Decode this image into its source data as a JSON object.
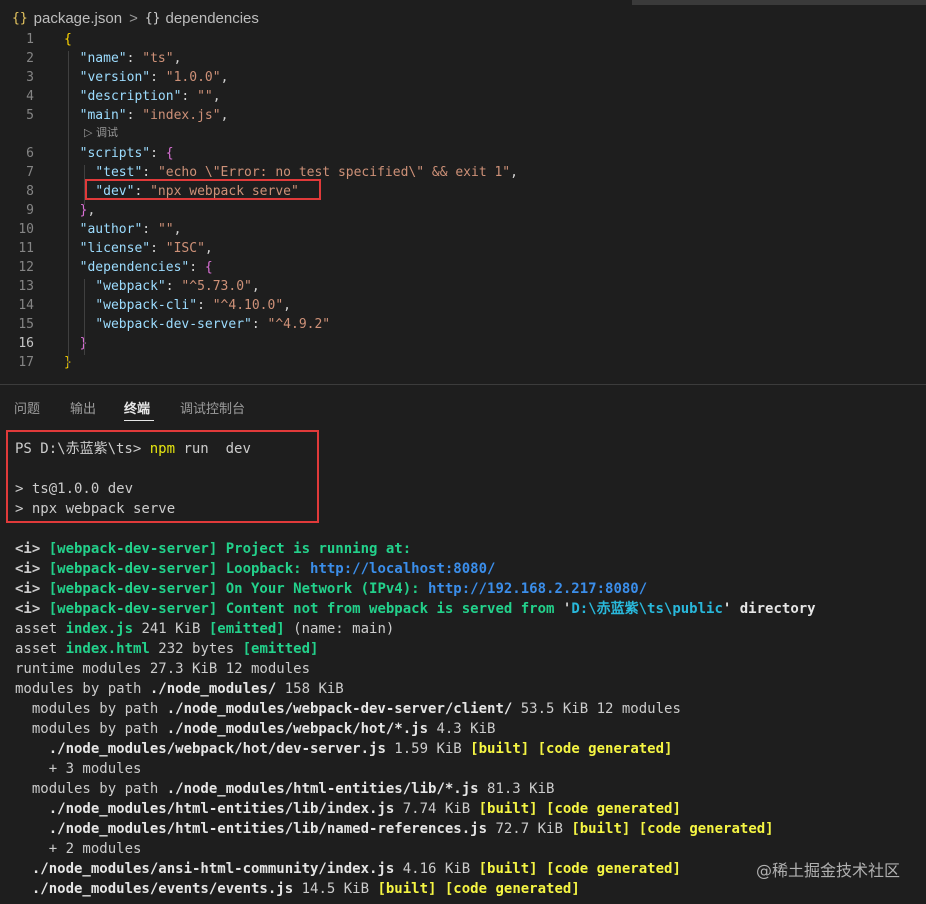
{
  "breadcrumb": {
    "file_icon": "{}",
    "file": "package.json",
    "separator": ">",
    "symbol_icon": "{}",
    "symbol": "dependencies"
  },
  "editor": {
    "active_line": 16,
    "code_lens": "▷ 调试",
    "lines": [
      {
        "n": "1",
        "tokens": [
          {
            "t": "{",
            "c": "b1"
          }
        ]
      },
      {
        "n": "2",
        "tokens": [
          {
            "t": "  "
          },
          {
            "t": "\"name\"",
            "c": "k"
          },
          {
            "t": ": ",
            "c": "p"
          },
          {
            "t": "\"ts\"",
            "c": "s"
          },
          {
            "t": ",",
            "c": "p"
          }
        ]
      },
      {
        "n": "3",
        "tokens": [
          {
            "t": "  "
          },
          {
            "t": "\"version\"",
            "c": "k"
          },
          {
            "t": ": ",
            "c": "p"
          },
          {
            "t": "\"1.0.0\"",
            "c": "s"
          },
          {
            "t": ",",
            "c": "p"
          }
        ]
      },
      {
        "n": "4",
        "tokens": [
          {
            "t": "  "
          },
          {
            "t": "\"description\"",
            "c": "k"
          },
          {
            "t": ": ",
            "c": "p"
          },
          {
            "t": "\"\"",
            "c": "s"
          },
          {
            "t": ",",
            "c": "p"
          }
        ]
      },
      {
        "n": "5",
        "tokens": [
          {
            "t": "  "
          },
          {
            "t": "\"main\"",
            "c": "k"
          },
          {
            "t": ": ",
            "c": "p"
          },
          {
            "t": "\"index.js\"",
            "c": "s"
          },
          {
            "t": ",",
            "c": "p"
          }
        ]
      },
      {
        "n": "6",
        "tokens": [
          {
            "t": "  "
          },
          {
            "t": "\"scripts\"",
            "c": "k"
          },
          {
            "t": ": ",
            "c": "p"
          },
          {
            "t": "{",
            "c": "b2"
          }
        ]
      },
      {
        "n": "7",
        "tokens": [
          {
            "t": "    "
          },
          {
            "t": "\"test\"",
            "c": "k"
          },
          {
            "t": ": ",
            "c": "p"
          },
          {
            "t": "\"echo \\\"Error: no test specified\\\" && exit 1\"",
            "c": "s"
          },
          {
            "t": ",",
            "c": "p"
          }
        ]
      },
      {
        "n": "8",
        "tokens": [
          {
            "t": "    "
          },
          {
            "t": "\"dev\"",
            "c": "k"
          },
          {
            "t": ": ",
            "c": "p"
          },
          {
            "t": "\"npx webpack serve\"",
            "c": "s"
          }
        ]
      },
      {
        "n": "9",
        "tokens": [
          {
            "t": "  "
          },
          {
            "t": "}",
            "c": "b2"
          },
          {
            "t": ",",
            "c": "p"
          }
        ]
      },
      {
        "n": "10",
        "tokens": [
          {
            "t": "  "
          },
          {
            "t": "\"author\"",
            "c": "k"
          },
          {
            "t": ": ",
            "c": "p"
          },
          {
            "t": "\"\"",
            "c": "s"
          },
          {
            "t": ",",
            "c": "p"
          }
        ]
      },
      {
        "n": "11",
        "tokens": [
          {
            "t": "  "
          },
          {
            "t": "\"license\"",
            "c": "k"
          },
          {
            "t": ": ",
            "c": "p"
          },
          {
            "t": "\"ISC\"",
            "c": "s"
          },
          {
            "t": ",",
            "c": "p"
          }
        ]
      },
      {
        "n": "12",
        "tokens": [
          {
            "t": "  "
          },
          {
            "t": "\"dependencies\"",
            "c": "k"
          },
          {
            "t": ": ",
            "c": "p"
          },
          {
            "t": "{",
            "c": "b2"
          }
        ]
      },
      {
        "n": "13",
        "tokens": [
          {
            "t": "    "
          },
          {
            "t": "\"webpack\"",
            "c": "k"
          },
          {
            "t": ": ",
            "c": "p"
          },
          {
            "t": "\"^5.73.0\"",
            "c": "s"
          },
          {
            "t": ",",
            "c": "p"
          }
        ]
      },
      {
        "n": "14",
        "tokens": [
          {
            "t": "    "
          },
          {
            "t": "\"webpack-cli\"",
            "c": "k"
          },
          {
            "t": ": ",
            "c": "p"
          },
          {
            "t": "\"^4.10.0\"",
            "c": "s"
          },
          {
            "t": ",",
            "c": "p"
          }
        ]
      },
      {
        "n": "15",
        "tokens": [
          {
            "t": "    "
          },
          {
            "t": "\"webpack-dev-server\"",
            "c": "k"
          },
          {
            "t": ": ",
            "c": "p"
          },
          {
            "t": "\"^4.9.2\"",
            "c": "s"
          }
        ]
      },
      {
        "n": "16",
        "tokens": [
          {
            "t": "  "
          },
          {
            "t": "}",
            "c": "b2"
          }
        ]
      },
      {
        "n": "17",
        "tokens": [
          {
            "t": "}",
            "c": "b1"
          }
        ]
      }
    ]
  },
  "panel": {
    "tabs": [
      {
        "label": "问题",
        "active": false
      },
      {
        "label": "输出",
        "active": false
      },
      {
        "label": "终端",
        "active": true
      },
      {
        "label": "调试控制台",
        "active": false
      }
    ]
  },
  "terminal": {
    "lines": [
      [
        {
          "t": "PS D:\\赤蓝紫\\ts> "
        },
        {
          "t": "npm",
          "c": "ty2"
        },
        {
          "t": " run  dev"
        }
      ],
      [
        {
          "t": ""
        }
      ],
      [
        {
          "t": "> ts@1.0.0 dev"
        }
      ],
      [
        {
          "t": "> npx webpack serve"
        }
      ],
      [
        {
          "t": ""
        }
      ],
      [
        {
          "t": "<i> ",
          "c": "tb"
        },
        {
          "t": "[webpack-dev-server] Project is running at:",
          "c": "tg"
        }
      ],
      [
        {
          "t": "<i> ",
          "c": "tb"
        },
        {
          "t": "[webpack-dev-server] Loopback: ",
          "c": "tg"
        },
        {
          "t": "http://localhost:8080/",
          "c": "tbl"
        }
      ],
      [
        {
          "t": "<i> ",
          "c": "tb"
        },
        {
          "t": "[webpack-dev-server] On Your Network (IPv4): ",
          "c": "tg"
        },
        {
          "t": "http://192.168.2.217:8080/",
          "c": "tbl"
        }
      ],
      [
        {
          "t": "<i> ",
          "c": "tb"
        },
        {
          "t": "[webpack-dev-server] Content not from webpack is served from ",
          "c": "tg"
        },
        {
          "t": "'",
          "c": "tb"
        },
        {
          "t": "D:\\赤蓝紫\\ts\\public",
          "c": "tc"
        },
        {
          "t": "' directory",
          "c": "tw"
        }
      ],
      [
        {
          "t": "asset "
        },
        {
          "t": "index.js",
          "c": "tg"
        },
        {
          "t": " 241 KiB "
        },
        {
          "t": "[emitted]",
          "c": "tg"
        },
        {
          "t": " (name: main)"
        }
      ],
      [
        {
          "t": "asset "
        },
        {
          "t": "index.html",
          "c": "tg"
        },
        {
          "t": " 232 bytes "
        },
        {
          "t": "[emitted]",
          "c": "tg"
        }
      ],
      [
        {
          "t": "runtime modules 27.3 KiB 12 modules"
        }
      ],
      [
        {
          "t": "modules by path "
        },
        {
          "t": "./node_modules/",
          "c": "tw"
        },
        {
          "t": " 158 KiB"
        }
      ],
      [
        {
          "t": "  modules by path "
        },
        {
          "t": "./node_modules/webpack-dev-server/client/",
          "c": "tw"
        },
        {
          "t": " 53.5 KiB 12 modules"
        }
      ],
      [
        {
          "t": "  modules by path "
        },
        {
          "t": "./node_modules/webpack/hot/*.js",
          "c": "tw"
        },
        {
          "t": " 4.3 KiB"
        }
      ],
      [
        {
          "t": "    "
        },
        {
          "t": "./node_modules/webpack/hot/dev-server.js",
          "c": "tw"
        },
        {
          "t": " 1.59 KiB "
        },
        {
          "t": "[built] [code generated]",
          "c": "ty"
        }
      ],
      [
        {
          "t": "    + 3 modules"
        }
      ],
      [
        {
          "t": "  modules by path "
        },
        {
          "t": "./node_modules/html-entities/lib/*.js",
          "c": "tw"
        },
        {
          "t": " 81.3 KiB"
        }
      ],
      [
        {
          "t": "    "
        },
        {
          "t": "./node_modules/html-entities/lib/index.js",
          "c": "tw"
        },
        {
          "t": " 7.74 KiB "
        },
        {
          "t": "[built] [code generated]",
          "c": "ty"
        }
      ],
      [
        {
          "t": "    "
        },
        {
          "t": "./node_modules/html-entities/lib/named-references.js",
          "c": "tw"
        },
        {
          "t": " 72.7 KiB "
        },
        {
          "t": "[built] [code generated]",
          "c": "ty"
        }
      ],
      [
        {
          "t": "    + 2 modules"
        }
      ],
      [
        {
          "t": "  "
        },
        {
          "t": "./node_modules/ansi-html-community/index.js",
          "c": "tw"
        },
        {
          "t": " 4.16 KiB "
        },
        {
          "t": "[built] [code generated]",
          "c": "ty"
        }
      ],
      [
        {
          "t": "  "
        },
        {
          "t": "./node_modules/events/events.js",
          "c": "tw"
        },
        {
          "t": " 14.5 KiB "
        },
        {
          "t": "[built] [code generated]",
          "c": "ty"
        }
      ]
    ]
  },
  "watermark": "@稀土掘金技术社区",
  "colors": {
    "background": "#1e1e1e",
    "highlight_border": "#e03a3a",
    "json_key": "#9cdcfe",
    "json_string": "#ce9178",
    "terminal_green": "#23d18b",
    "terminal_blue": "#3b8eea",
    "terminal_yellow": "#f5f543"
  }
}
